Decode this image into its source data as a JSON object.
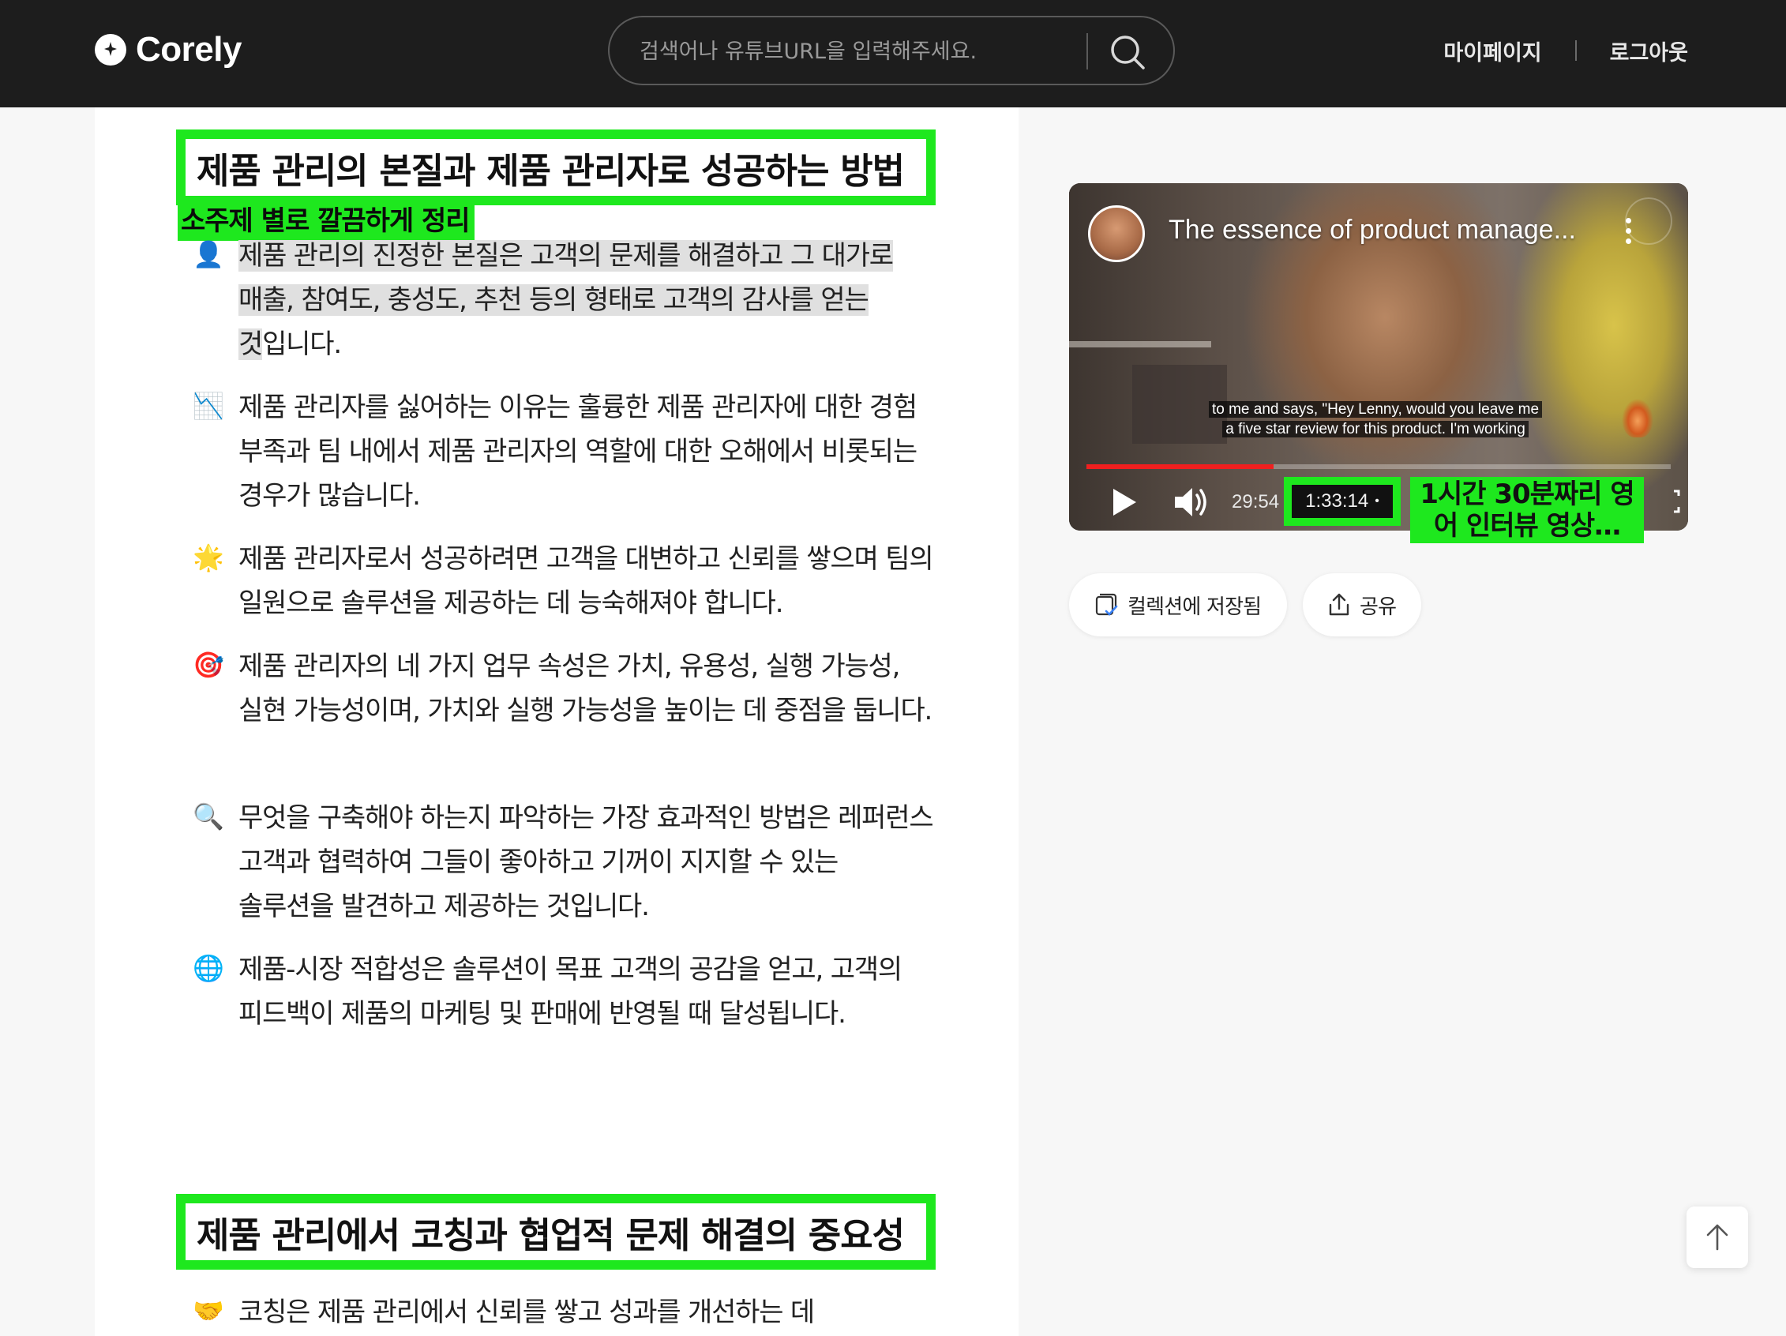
{
  "header": {
    "brand": "Corely",
    "search_placeholder": "검색어나 유튜브URL을 입력해주세요.",
    "nav": {
      "mypage": "마이페이지",
      "logout": "로그아웃"
    }
  },
  "summary": {
    "sections": [
      {
        "title": "제품 관리의 본질과 제품 관리자로 성공하는 방법",
        "subtitle": "소주제 별로 깔끔하게 정리",
        "bullets": [
          {
            "icon": "bust-in-silhouette",
            "emoji": "👤",
            "text_highlight": "제품 관리의 진정한 본질은 고객의 문제를 해결하고 그 대가로 매출, 참여도, 충성도, 추천 등의 형태로 고객의 감사를 얻는 것",
            "text_rest": "입니다."
          },
          {
            "icon": "chart-decreasing",
            "emoji": "📉",
            "text": "제품 관리자를 싫어하는 이유는 훌륭한 제품 관리자에 대한 경험 부족과 팀 내에서 제품 관리자의 역할에 대한 오해에서 비롯되는 경우가 많습니다."
          },
          {
            "icon": "glowing-star",
            "emoji": "🌟",
            "text": "제품 관리자로서 성공하려면 고객을 대변하고 신뢰를 쌓으며 팀의 일원으로 솔루션을 제공하는 데 능숙해져야 합니다."
          },
          {
            "icon": "direct-hit",
            "emoji": "🎯",
            "text": "제품 관리자의 네 가지 업무 속성은 가치, 유용성, 실행 가능성, 실현 가능성이며, 가치와 실행 가능성을 높이는 데 중점을 둡니다."
          },
          {
            "icon": "magnifying-glass",
            "emoji": "🔍",
            "text": "무엇을 구축해야 하는지 파악하는 가장 효과적인 방법은 레퍼런스 고객과 협력하여 그들이 좋아하고 기꺼이 지지할 수 있는 솔루션을 발견하고 제공하는 것입니다."
          },
          {
            "icon": "globe-with-meridians",
            "emoji": "🌐",
            "text": "제품-시장 적합성은 솔루션이 목표 고객의 공감을 얻고, 고객의 피드백이 제품의 마케팅 및 판매에 반영될 때 달성됩니다."
          }
        ]
      },
      {
        "title": "제품 관리에서 코칭과 협업적 문제 해결의 중요성",
        "bullets": [
          {
            "icon": "handshake",
            "emoji": "🤝",
            "text": "코칭은 제품 관리에서 신뢰를 쌓고 성과를 개선하는 데"
          }
        ]
      }
    ]
  },
  "video": {
    "title": "The essence of product manage...",
    "caption_line1": "to me and says, \"Hey Lenny, would you leave me",
    "caption_line2": "a five star review for this product. I'm working",
    "current_time": "29:54",
    "duration": "1:33:14",
    "duration_dot": "•",
    "progress": 0.32,
    "duration_note": "1시간 30분짜리 영어 인터뷰 영상…"
  },
  "actions": {
    "save": "컬렉션에 저장됨",
    "share": "공유"
  },
  "colors": {
    "header_bg": "#1d1d1d",
    "highlight_green": "#1ee81e",
    "progress_red": "#f01f1f",
    "text_highlight_bg": "#e0e0e0"
  }
}
